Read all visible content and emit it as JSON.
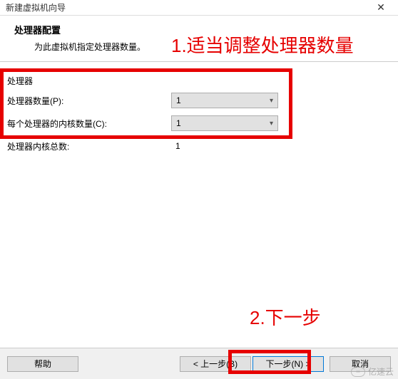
{
  "titlebar": {
    "title": "新建虚拟机向导"
  },
  "header": {
    "title": "处理器配置",
    "subtitle": "为此虚拟机指定处理器数量。"
  },
  "section": {
    "group_label": "处理器",
    "rows": [
      {
        "label": "处理器数量(P):",
        "value": "1",
        "type": "dropdown"
      },
      {
        "label": "每个处理器的内核数量(C):",
        "value": "1",
        "type": "dropdown"
      },
      {
        "label": "处理器内核总数:",
        "value": "1",
        "type": "static"
      }
    ]
  },
  "footer": {
    "help": "帮助",
    "back": "< 上一步(B)",
    "next": "下一步(N) >",
    "cancel": "取消"
  },
  "annotations": {
    "a1": "1.适当调整处理器数量",
    "a2": "2.下一步"
  },
  "watermark": {
    "text": "亿速云"
  }
}
